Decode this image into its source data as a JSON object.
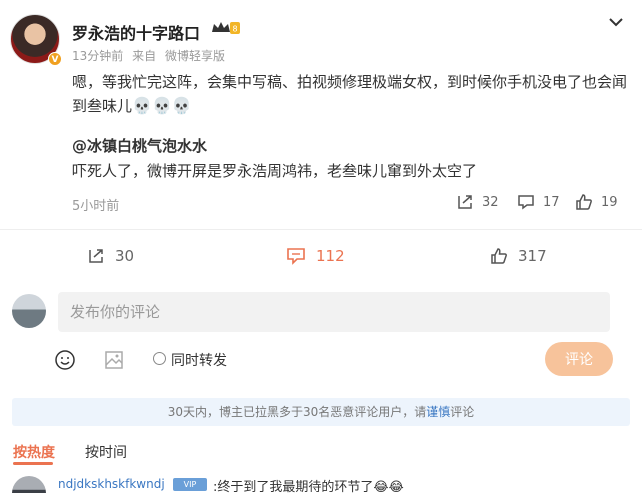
{
  "post": {
    "username": "罗永浩的十字路口",
    "vip_level": "8",
    "avatar_badge": "V",
    "time": "13分钟前",
    "source_prefix": "来自",
    "source": "微博轻享版",
    "text": "嗯，等我忙完这阵，会集中写稿、拍视频修理极端女权，到时候你手机没电了也会闻到叁味儿",
    "emojis": "💀💀💀"
  },
  "repost": {
    "user": "@冰镇白桃气泡水水",
    "text": "吓死人了，微博开屏是罗永浩周鸿祎，老叁味儿窜到外太空了",
    "time": "5小时前",
    "reposts": "32",
    "comments": "17",
    "likes": "19"
  },
  "actions": {
    "reposts": "30",
    "comments": "112",
    "likes": "317"
  },
  "comment_box": {
    "placeholder": "发布你的评论",
    "repost_label": "同时转发",
    "submit_label": "评论"
  },
  "notice": {
    "text_before": "30天内，博主已拉黑多于30名恶意评论用户，请",
    "link": "谨慎",
    "text_after": "评论"
  },
  "sort": {
    "hot": "按热度",
    "time": "按时间"
  },
  "first_comment": {
    "user": "ndjdkskhskfkwndj",
    "badge": "VIP",
    "text": ":终于到了我最期待的环节了😂😂"
  },
  "colors": {
    "accent": "#eb7350",
    "link": "#3a77c2",
    "submit_disabled": "#f7c39b"
  }
}
